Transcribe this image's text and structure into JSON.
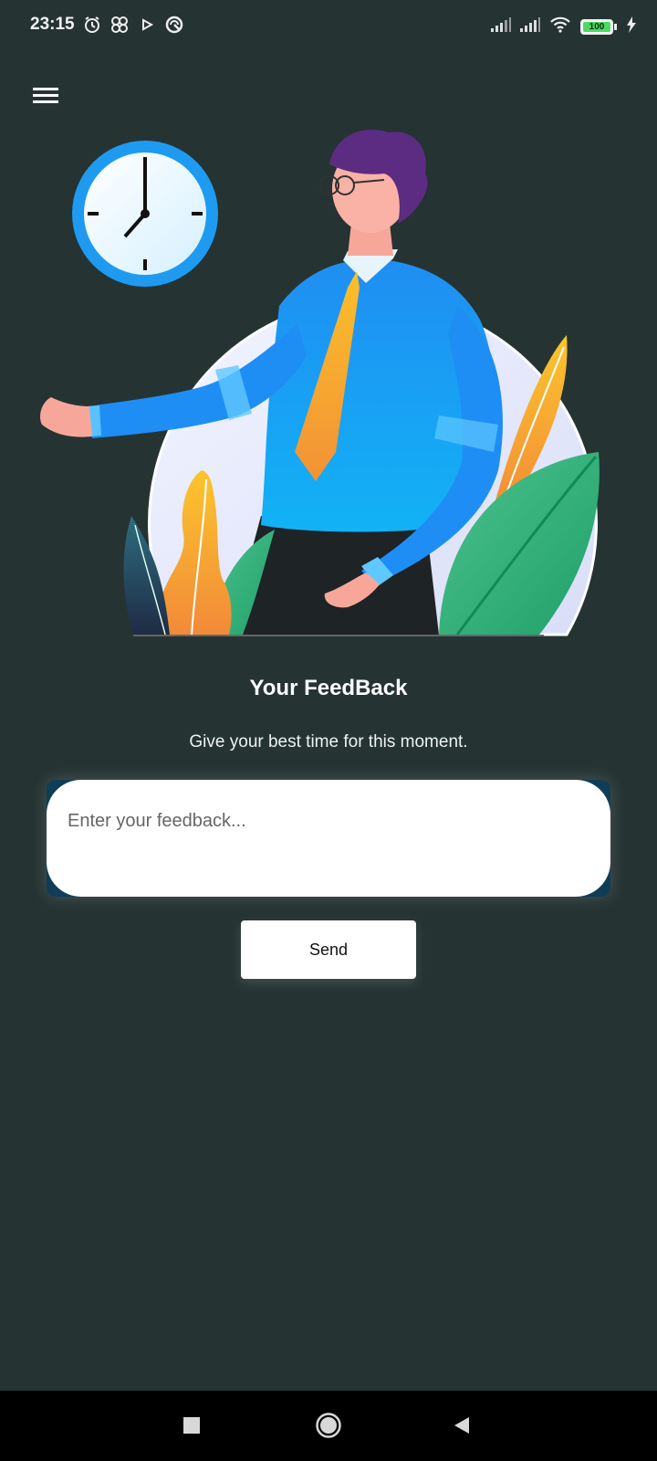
{
  "status_bar": {
    "time": "23:15",
    "battery": "100",
    "icons_left": [
      "alarm-icon",
      "pinwheel-icon",
      "play-icon",
      "vpn-icon"
    ],
    "icons_right": [
      "signal-icon",
      "signal-icon",
      "wifi-icon",
      "battery-icon",
      "charging-icon"
    ]
  },
  "header": {
    "menu_icon": "hamburger-menu-icon"
  },
  "illustration": {
    "description_icon": "businessman-clock-illustration"
  },
  "main": {
    "title": "Your FeedBack",
    "subtitle": "Give your best time for this moment.",
    "feedback_placeholder": "Enter your feedback...",
    "feedback_value": "",
    "send_label": "Send"
  },
  "nav_bar": {
    "buttons": [
      "recents-square-icon",
      "home-circle-icon",
      "back-triangle-icon"
    ]
  },
  "colors": {
    "background": "#253333",
    "input_frame": "#0f3d57",
    "accent_blue": "#1e9bf0",
    "accent_orange": "#f6a437",
    "leaf_green": "#36b37e"
  }
}
